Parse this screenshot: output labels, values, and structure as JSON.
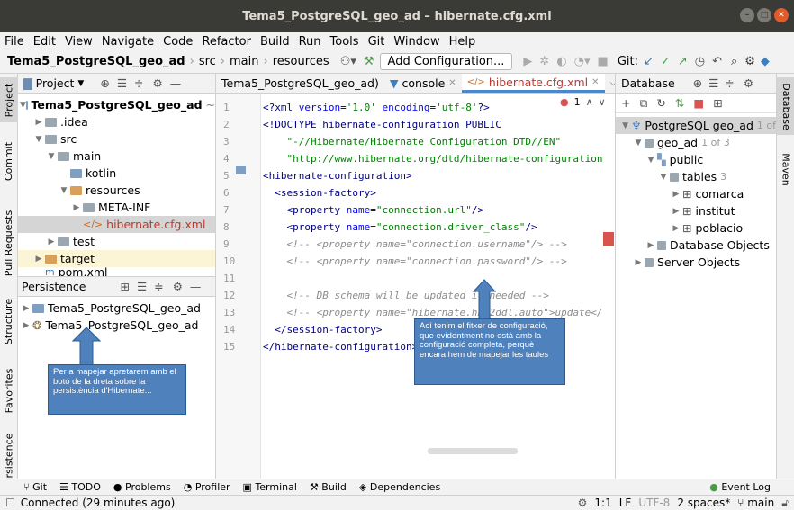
{
  "window": {
    "title": "Tema5_PostgreSQL_geo_ad – hibernate.cfg.xml"
  },
  "menu": [
    "File",
    "Edit",
    "View",
    "Navigate",
    "Code",
    "Refactor",
    "Build",
    "Run",
    "Tools",
    "Git",
    "Window",
    "Help"
  ],
  "breadcrumb": [
    "Tema5_PostgreSQL_geo_ad",
    "src",
    "main",
    "resources"
  ],
  "toolbar": {
    "add_config": "Add Configuration...",
    "git_label": "Git:"
  },
  "left_tabs": [
    "Project",
    "Commit",
    "Pull Requests",
    "Structure",
    "Favorites",
    "rsistence"
  ],
  "right_tabs": [
    "Database",
    "Maven"
  ],
  "project": {
    "title": "Project",
    "root": "Tema5_PostgreSQL_geo_ad",
    "root_path": "~",
    "items": [
      ".idea",
      "src",
      "main",
      "kotlin",
      "resources",
      "META-INF",
      "hibernate.cfg.xml",
      "test",
      "target",
      "pom.xml"
    ]
  },
  "persistence": {
    "title": "Persistence",
    "items": [
      "Tema5_PostgreSQL_geo_ad",
      "Tema5_PostgreSQL_geo_ad"
    ]
  },
  "editor": {
    "tabs": [
      "Tema5_PostgreSQL_geo_ad)",
      "console",
      "hibernate.cfg.xml"
    ],
    "error_count": "1",
    "line_numbers": [
      "1",
      "2",
      "3",
      "4",
      "5",
      "6",
      "7",
      "8",
      "9",
      "10",
      "11",
      "12",
      "13",
      "14",
      "15"
    ]
  },
  "database": {
    "title": "Database",
    "connection": "PostgreSQL geo_ad",
    "connection_count": "1 of",
    "db": "geo_ad",
    "db_count": "1 of 3",
    "schema": "public",
    "tables_label": "tables",
    "tables_count": "3",
    "tables": [
      "comarca",
      "institut",
      "poblacio"
    ],
    "db_objects": "Database Objects",
    "server_objects": "Server Objects"
  },
  "bottom_tools": [
    "Git",
    "TODO",
    "Problems",
    "Profiler",
    "Terminal",
    "Build",
    "Dependencies",
    "Event Log"
  ],
  "status": {
    "message": "Connected (29 minutes ago)",
    "position": "1:1",
    "line_sep": "LF",
    "encoding": "UTF-8",
    "indent": "2 spaces*",
    "branch": "main"
  },
  "notes": {
    "left": "Per a mapejar apretarem amb el botó de la dreta sobre la persistència d'Hibernate...",
    "right": "Ací tenim el fitxer de configuració, que evidentment no està amb la configuració completa, perquè encara hem de mapejar les taules"
  }
}
